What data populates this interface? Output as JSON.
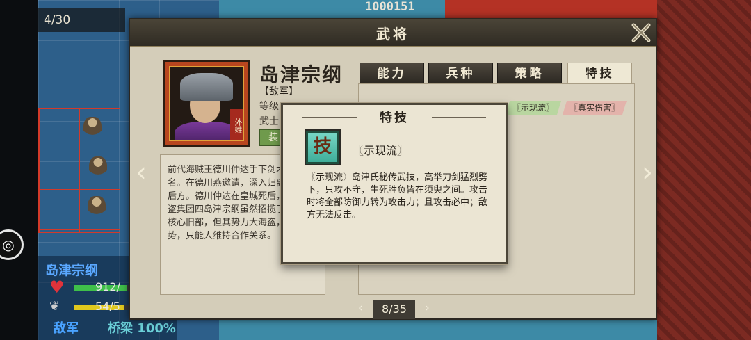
{
  "map": {
    "turn_counter": "4/30",
    "score": "1000151",
    "unit_name": "岛津宗纲",
    "hp_value": "912/",
    "hp_fraction": 0.95,
    "mp_value": "54/5",
    "mp_fraction": 0.9,
    "faction": "敌军",
    "terrain": "桥梁 100%"
  },
  "dialog": {
    "title": "武将",
    "name": "岛津宗纲",
    "faction_tag": "【敌军】",
    "level_label": "等级",
    "class_label": "武士",
    "equip_label": "装",
    "portrait_tag": "外姓",
    "bio": "前代海贼王德川仲达手下剑术高超而闻名。在德川燕邀请，深入归离大陆时守后方。德川仲达在皇城死后，其麾下海盗集团四岛津宗纲虽然招揽了一批达的核心旧部，但其势力大海盗，已无优势，只能人维持合作关系。",
    "tabs": [
      {
        "label": "能力",
        "active": false
      },
      {
        "label": "兵种",
        "active": false
      },
      {
        "label": "策略",
        "active": false
      },
      {
        "label": "特技",
        "active": true
      }
    ],
    "skill_tags": [
      "〖示现流〗",
      "〖真实伤害〗"
    ],
    "page": "8/35"
  },
  "popup": {
    "title": "特技",
    "icon_char": "技",
    "skill_name": "〖示现流〗",
    "description": "〖示现流〗岛津氏秘传武技，高举刀剑猛烈劈下，只攻不守，生死胜负皆在须臾之间。攻击时将全部防御力转为攻击力；且攻击必中；敌方无法反击。"
  },
  "colors": {
    "hp": "#3fbf4a",
    "mp": "#e0c81e",
    "accent": "#8d7e5a",
    "tag_green": "#b9d6a0",
    "tag_red": "#e3b3ab"
  }
}
